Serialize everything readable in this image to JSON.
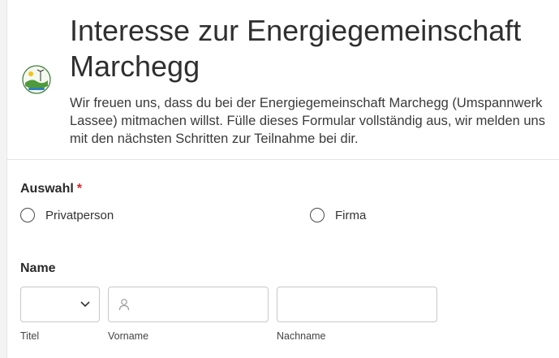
{
  "header": {
    "title": "Interesse zur Energiegemeinschaft Marchegg",
    "description": "Wir freuen uns, dass du bei der Energiegemeinschaft Marchegg (Umspannwerk Lassee) mitmachen willst. Fülle dieses Formular vollständig aus, wir melden uns mit den nächsten Schritten zur Teilnahme bei dir.",
    "logo_icon": "energy-community-logo-icon"
  },
  "auswahl": {
    "label": "Auswahl",
    "required_marker": "*",
    "options": [
      "Privatperson",
      "Firma"
    ]
  },
  "name": {
    "label": "Name",
    "fields": [
      {
        "caption": "Titel",
        "value": "",
        "icon": "chevron-down-icon"
      },
      {
        "caption": "Vorname",
        "value": "",
        "icon": "person-icon"
      },
      {
        "caption": "Nachname",
        "value": ""
      }
    ]
  },
  "colors": {
    "required": "#d9232e",
    "text": "#2b2b2b",
    "border": "#c8c8c8"
  }
}
